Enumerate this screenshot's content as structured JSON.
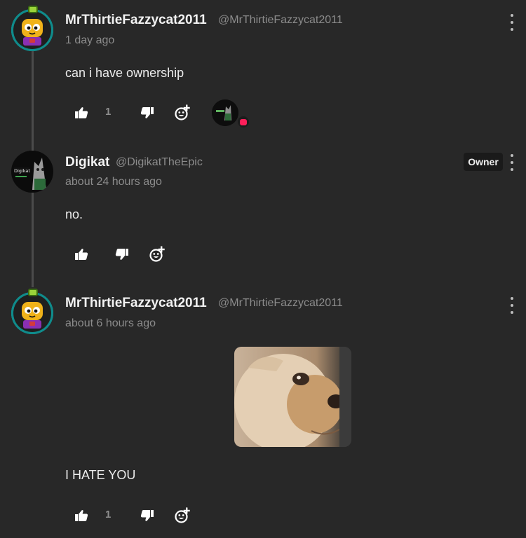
{
  "comments": [
    {
      "username": "MrThirtieFazzycat2011",
      "handle": "@MrThirtieFazzycat2011",
      "timestamp": "1 day ago",
      "text": "can i have ownership",
      "likes": "1",
      "has_reactor": true
    },
    {
      "username": "Digikat",
      "handle": "@DigikatTheEpic",
      "timestamp": "about 24 hours ago",
      "text": "no.",
      "badge": "Owner",
      "avatar_text": "Digikat"
    },
    {
      "username": "MrThirtieFazzycat2011",
      "handle": "@MrThirtieFazzycat2011",
      "timestamp": "about 6 hours ago",
      "text": "I HATE YOU",
      "likes": "1",
      "has_image": true
    }
  ],
  "icons": {
    "like": "thumbs-up-icon",
    "dislike": "thumbs-down-icon",
    "react": "add-reaction-icon",
    "menu": "more-vertical-icon"
  },
  "colors": {
    "background": "#282828",
    "reaction_accent": "#ff1f5a",
    "avatar_teal": "#19b3b3"
  }
}
